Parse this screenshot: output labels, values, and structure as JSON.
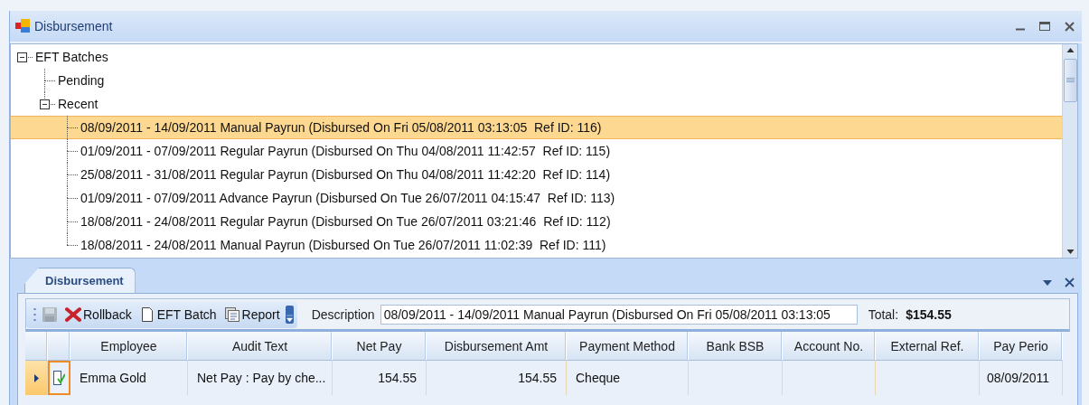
{
  "window": {
    "title": "Disbursement"
  },
  "tree": [
    {
      "label": "EFT Batches",
      "expanded": true,
      "selected": false,
      "children": [
        {
          "label": "Pending",
          "selected": false
        },
        {
          "label": "Recent",
          "expanded": true,
          "selected": false,
          "children": [
            {
              "label": "08/09/2011 - 14/09/2011 Manual Payrun (Disbursed On Fri 05/08/2011 03:13:05  Ref ID: 116)",
              "selected": true
            },
            {
              "label": "01/09/2011 - 07/09/2011 Regular Payrun (Disbursed On Thu 04/08/2011 11:42:57  Ref ID: 115)",
              "selected": false
            },
            {
              "label": "25/08/2011 - 31/08/2011 Regular Payrun (Disbursed On Thu 04/08/2011 11:42:20  Ref ID: 114)",
              "selected": false
            },
            {
              "label": "01/09/2011 - 07/09/2011 Advance Payrun (Disbursed On Tue 26/07/2011 04:15:47  Ref ID: 113)",
              "selected": false
            },
            {
              "label": "18/08/2011 - 24/08/2011 Regular Payrun (Disbursed On Tue 26/07/2011 03:21:46  Ref ID: 112)",
              "selected": false
            },
            {
              "label": "18/08/2011 - 24/08/2011 Manual Payrun (Disbursed On Tue 26/07/2011 11:02:39  Ref ID: 111)",
              "selected": false
            }
          ]
        }
      ]
    }
  ],
  "panel": {
    "tabs": [
      {
        "label": "Disbursement",
        "selected": true
      }
    ],
    "toolbar": [
      {
        "kind": "save",
        "disabled": true
      },
      {
        "kind": "rollback",
        "label": "Rollback",
        "disabled": false
      },
      {
        "kind": "batch",
        "label": "EFT Batch",
        "disabled": false
      },
      {
        "kind": "report",
        "label": "Report",
        "disabled": false
      }
    ],
    "description": {
      "label": "Description",
      "value": "08/09/2011 - 14/09/2011 Manual Payrun (Disbursed On Fri 05/08/2011 03:13:05"
    },
    "total": {
      "label": "Total:",
      "value": "$154.55"
    },
    "table": {
      "columns": [
        "",
        "Employee",
        "Audit Text",
        "Net Pay",
        "Disbursement Amt",
        "Payment Method",
        "Bank BSB",
        "Account No.",
        "External Ref.",
        "Pay Perio"
      ],
      "rows": [
        {
          "selected": true,
          "current": true,
          "cells": [
            "",
            "Emma Gold",
            "Net Pay : Pay by che...",
            "154.55",
            "154.55",
            "Cheque",
            "",
            "",
            "",
            "08/09/2011"
          ]
        }
      ]
    }
  }
}
